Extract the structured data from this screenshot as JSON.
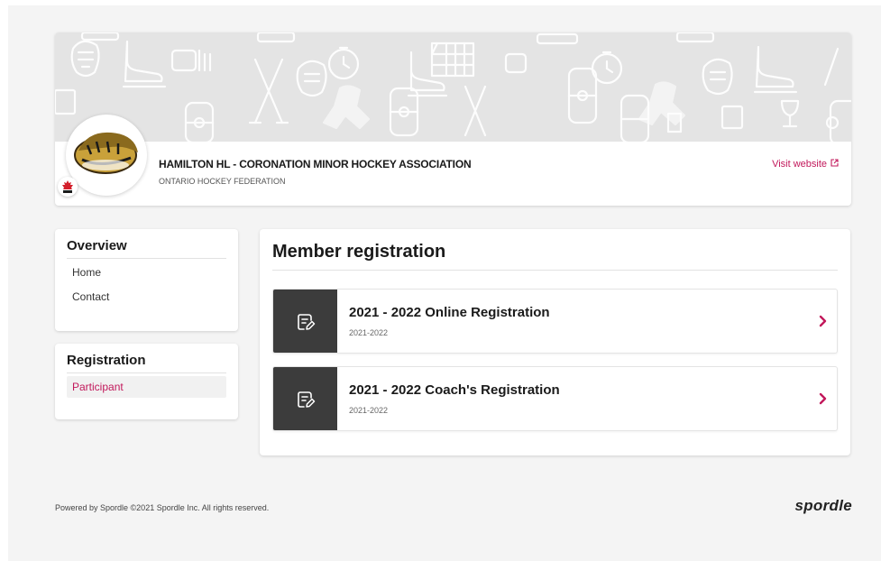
{
  "header": {
    "org_name": "HAMILTON HL - CORONATION MINOR HOCKEY ASSOCIATION",
    "federation": "ONTARIO HOCKEY FEDERATION",
    "visit_label": "Visit website"
  },
  "sidebar": {
    "overview": {
      "title": "Overview",
      "items": [
        {
          "label": "Home"
        },
        {
          "label": "Contact"
        }
      ]
    },
    "registration": {
      "title": "Registration",
      "items": [
        {
          "label": "Participant",
          "active": true
        }
      ]
    }
  },
  "main": {
    "title": "Member registration",
    "registrations": [
      {
        "title": "2021 - 2022 Online Registration",
        "season": "2021-2022"
      },
      {
        "title": "2021 - 2022 Coach's Registration",
        "season": "2021-2022"
      }
    ]
  },
  "footer": {
    "text": "Powered by Spordle ©2021 Spordle Inc. All rights reserved.",
    "brand": "spordle"
  },
  "colors": {
    "accent": "#c2185b",
    "icon_bg": "#3c3c3c",
    "banner_bg": "#e4e4e4",
    "page_bg": "#f4f4f4"
  },
  "icons": {
    "registration": "edit-document-icon",
    "chevron": "chevron-right-icon",
    "external": "external-link-icon"
  }
}
